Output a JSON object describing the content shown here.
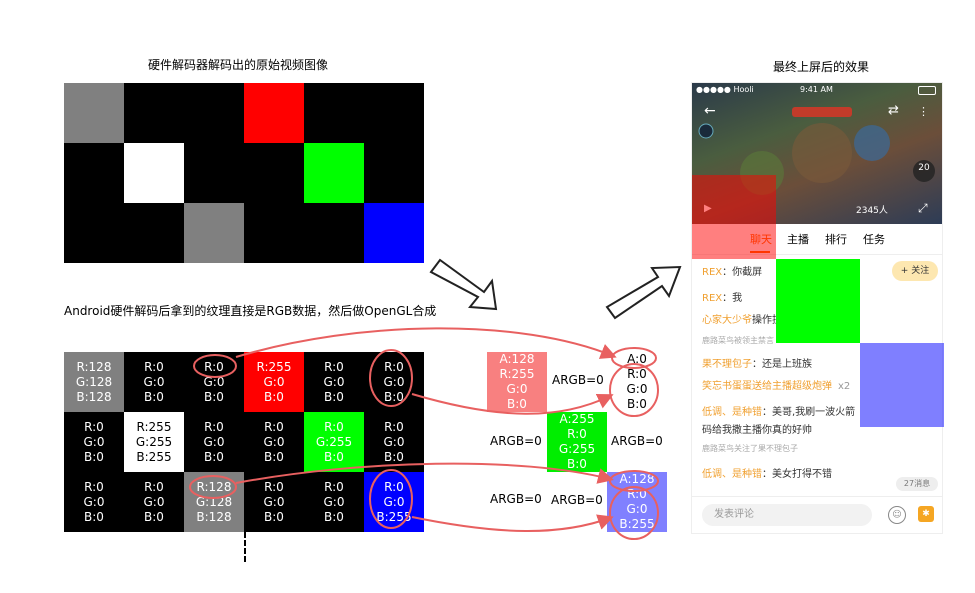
{
  "left": {
    "title": "硬件解码器解码出的原始视频图像",
    "caption2": "Android硬件解码后拿到的纹理直接是RGB数据，然后做OpenGL合成",
    "blocks": [
      [
        "#808080",
        "#000000",
        "#000000",
        "#ff0000",
        "#000000",
        "#000000"
      ],
      [
        "#000000",
        "#ffffff",
        "#000000",
        "#000000",
        "#00ff00",
        "#000000"
      ],
      [
        "#000000",
        "#000000",
        "#808080",
        "#000000",
        "#000000",
        "#0000ff"
      ]
    ],
    "values": [
      [
        {
          "bg": "#808080",
          "fg": "#ffffff",
          "lines": [
            "R:128",
            "G:128",
            "B:128"
          ]
        },
        {
          "bg": "#000000",
          "fg": "#ffffff",
          "lines": [
            "R:0",
            "G:0",
            "B:0"
          ]
        },
        {
          "bg": "#000000",
          "fg": "#ffffff",
          "lines": [
            "R:0",
            "G:0",
            "B:0"
          ]
        },
        {
          "bg": "#ff0000",
          "fg": "#ffffff",
          "lines": [
            "R:255",
            "G:0",
            "B:0"
          ]
        },
        {
          "bg": "#000000",
          "fg": "#ffffff",
          "lines": [
            "R:0",
            "G:0",
            "B:0"
          ]
        },
        {
          "bg": "#000000",
          "fg": "#ffffff",
          "lines": [
            "R:0",
            "G:0",
            "B:0"
          ]
        }
      ],
      [
        {
          "bg": "#000000",
          "fg": "#ffffff",
          "lines": [
            "R:0",
            "G:0",
            "B:0"
          ]
        },
        {
          "bg": "#ffffff",
          "fg": "#000000",
          "lines": [
            "R:255",
            "G:255",
            "B:255"
          ]
        },
        {
          "bg": "#000000",
          "fg": "#ffffff",
          "lines": [
            "R:0",
            "G:0",
            "B:0"
          ]
        },
        {
          "bg": "#000000",
          "fg": "#ffffff",
          "lines": [
            "R:0",
            "G:0",
            "B:0"
          ]
        },
        {
          "bg": "#00ff00",
          "fg": "#ffffff",
          "lines": [
            "R:0",
            "G:255",
            "B:0"
          ]
        },
        {
          "bg": "#000000",
          "fg": "#ffffff",
          "lines": [
            "R:0",
            "G:0",
            "B:0"
          ]
        }
      ],
      [
        {
          "bg": "#000000",
          "fg": "#ffffff",
          "lines": [
            "R:0",
            "G:0",
            "B:0"
          ]
        },
        {
          "bg": "#000000",
          "fg": "#ffffff",
          "lines": [
            "R:0",
            "G:0",
            "B:0"
          ]
        },
        {
          "bg": "#808080",
          "fg": "#ffffff",
          "lines": [
            "R:128",
            "G:128",
            "B:128"
          ]
        },
        {
          "bg": "#000000",
          "fg": "#ffffff",
          "lines": [
            "R:0",
            "G:0",
            "B:0"
          ]
        },
        {
          "bg": "#000000",
          "fg": "#ffffff",
          "lines": [
            "R:0",
            "G:0",
            "B:0"
          ]
        },
        {
          "bg": "#0000ff",
          "fg": "#ffffff",
          "lines": [
            "R:0",
            "G:0",
            "B:255"
          ]
        }
      ]
    ]
  },
  "middle": {
    "argb_labels": [
      "ARGB=0",
      "ARGB=0",
      "ARGB=0",
      "ARGB=0",
      "ARGB=0"
    ],
    "pixels": [
      {
        "bg": "#f88080",
        "lines": [
          "A:128",
          "R:255",
          "G:0",
          "B:0"
        ]
      },
      {
        "bg": "#ffffff",
        "fg": "#000000",
        "lines": [
          "A:0",
          "R:0",
          "G:0",
          "B:0"
        ]
      },
      {
        "bg": "#00ee00",
        "lines": [
          "A:255",
          "R:0",
          "G:255",
          "B:0"
        ]
      },
      {
        "bg": "#8080ff",
        "lines": [
          "A:128",
          "R:0",
          "G:0",
          "B:255"
        ]
      }
    ]
  },
  "right": {
    "title": "最终上屏后的效果",
    "status": {
      "carrier": "●●●●● Hooli",
      "time": "9:41 AM"
    },
    "video_overlay": {
      "viewers": "2345人",
      "pill": "20"
    },
    "tabs": [
      "聊天",
      "主播",
      "排行",
      "任务"
    ],
    "follow_button": "+ 关注",
    "messages": [
      {
        "user": "REX",
        "text": "：你截屏"
      },
      {
        "user": "REX",
        "text": "：我"
      },
      {
        "user": "心家大少爷",
        "text": "操作技术不错"
      },
      {
        "user": "",
        "text": "鹿路菜鸟被领主禁言",
        "system": true
      },
      {
        "user": "果不理包子",
        "text": "：还是上班族"
      },
      {
        "user": "",
        "text": "笑忘书蛋蛋送给主播超级炮弹",
        "gift": "x2"
      },
      {
        "user": "低调、是种错",
        "text": "：美哥,我刷一波火箭"
      },
      {
        "user": "",
        "text": "码给我撒主播你真的好帅"
      },
      {
        "user": "",
        "text": "鹿路菜鸟关注了果不理包子",
        "system": true
      },
      {
        "user": "低调、是种错",
        "text": "：美女打得不错"
      }
    ],
    "new_msgs": "27消息",
    "input_placeholder": "发表评论",
    "colors": {
      "accent": "#f5a623",
      "username": "#f0a030",
      "tab_active": "#ff6a00"
    }
  }
}
